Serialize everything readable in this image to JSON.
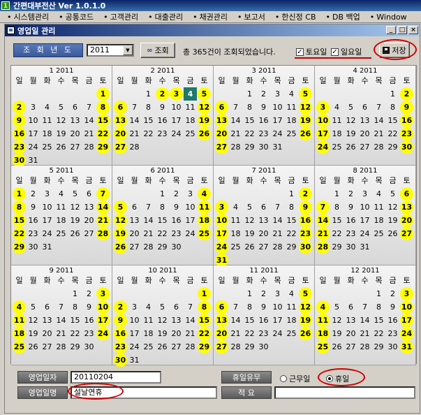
{
  "window": {
    "title": "간편대부전산 Ver 1.0.1.0",
    "app_icon": "1"
  },
  "menu": [
    "시스템관리",
    "공통코드",
    "고객관리",
    "대출관리",
    "채권관리",
    "보고서",
    "한신정 CB",
    "DB 백업",
    "Window"
  ],
  "child": {
    "title": "영업일 관리"
  },
  "toolbar": {
    "year_label": "조 회 년 도",
    "year_value": "2011",
    "search_label": "조회",
    "status": "총 365건이 조회되었습니다.",
    "saturday_label": "토요일",
    "sunday_label": "일요일",
    "save_label": "저장"
  },
  "weekdays": [
    "일",
    "월",
    "화",
    "수",
    "목",
    "금",
    "토"
  ],
  "months": [
    {
      "title": "1 2011",
      "start": 6,
      "days": 31,
      "hol": [
        1,
        2,
        8,
        9,
        15,
        16,
        22,
        23,
        29,
        30
      ]
    },
    {
      "title": "2 2011",
      "start": 2,
      "days": 28,
      "hol": [
        2,
        3,
        4,
        5,
        6,
        12,
        13,
        19,
        20,
        26,
        27
      ],
      "sel": 4
    },
    {
      "title": "3 2011",
      "start": 2,
      "days": 31,
      "hol": [
        5,
        6,
        12,
        13,
        19,
        20,
        26,
        27
      ]
    },
    {
      "title": "4 2011",
      "start": 5,
      "days": 30,
      "hol": [
        2,
        3,
        9,
        10,
        16,
        17,
        23,
        24,
        30
      ]
    },
    {
      "title": "5 2011",
      "start": 0,
      "days": 31,
      "hol": [
        1,
        7,
        8,
        14,
        15,
        21,
        22,
        28,
        29
      ]
    },
    {
      "title": "6 2011",
      "start": 3,
      "days": 30,
      "hol": [
        4,
        5,
        11,
        12,
        18,
        19,
        25,
        26
      ]
    },
    {
      "title": "7 2011",
      "start": 5,
      "days": 31,
      "hol": [
        2,
        3,
        9,
        10,
        16,
        17,
        23,
        24,
        30,
        31
      ]
    },
    {
      "title": "8 2011",
      "start": 1,
      "days": 31,
      "hol": [
        6,
        7,
        13,
        14,
        20,
        21,
        27,
        28
      ]
    },
    {
      "title": "9 2011",
      "start": 4,
      "days": 30,
      "hol": [
        3,
        4,
        10,
        11,
        17,
        18,
        24,
        25
      ]
    },
    {
      "title": "10 2011",
      "start": 6,
      "days": 31,
      "hol": [
        1,
        2,
        8,
        9,
        15,
        16,
        22,
        23,
        29,
        30
      ]
    },
    {
      "title": "11 2011",
      "start": 2,
      "days": 30,
      "hol": [
        5,
        6,
        12,
        13,
        19,
        20,
        26,
        27
      ]
    },
    {
      "title": "12 2011",
      "start": 4,
      "days": 31,
      "hol": [
        3,
        4,
        10,
        11,
        17,
        18,
        24,
        25,
        31
      ]
    }
  ],
  "form": {
    "date_label": "영업일자",
    "date_value": "20110204",
    "name_label": "영업일명",
    "name_value": "설날연휴",
    "holiday_label": "휴일유무",
    "workday_option": "근무일",
    "holiday_option": "휴일",
    "note_label": "적 요",
    "note_value": ""
  },
  "colors": {
    "holiday": "#ffff00",
    "selected": "#1e7a6a",
    "annotation": "#d00000"
  }
}
